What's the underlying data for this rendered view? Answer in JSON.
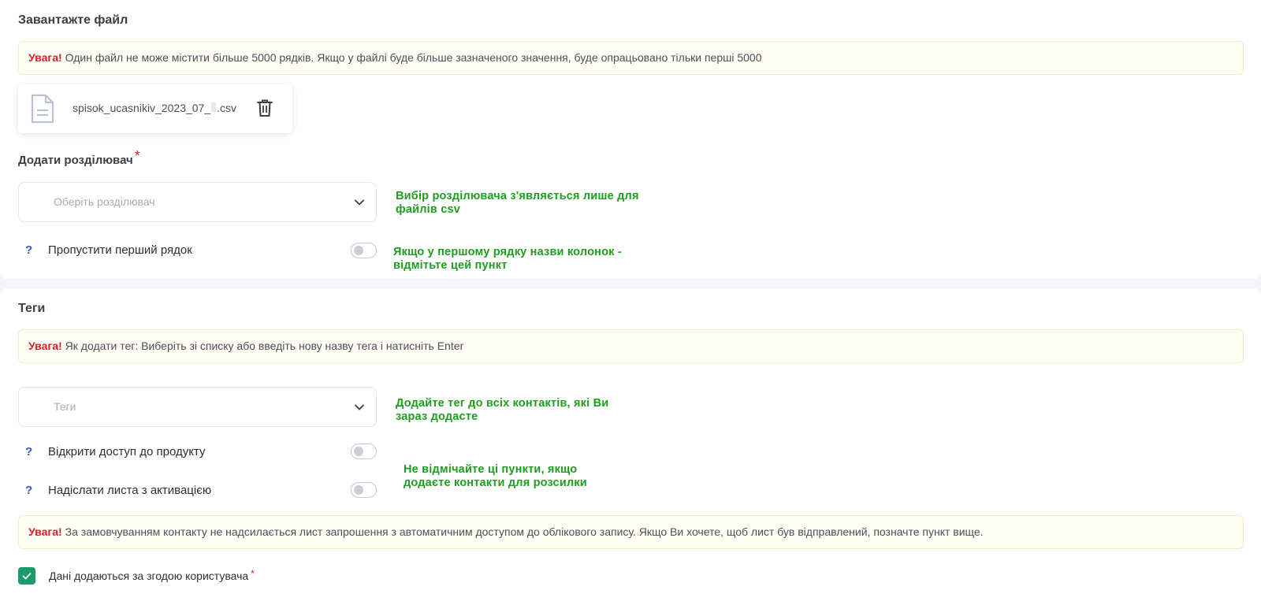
{
  "upload": {
    "title": "Завантажте файл",
    "notice_warn": "Увага!",
    "notice_text": "Один файл не може містити більше 5000 рядків. Якщо у файлі буде більше зазначеного значення, буде опрацьовано тільки перші 5000",
    "file_name": "spisok_ucasnikiv_2023_07_",
    "file_ext": ".csv",
    "file_icon": "document-icon",
    "delete_icon": "trash-icon"
  },
  "separator": {
    "label": "Додати розділювач",
    "required_mark": "*",
    "placeholder": "Оберіть розділювач",
    "hint_line1": "Вибір розділювача з'являється лише для",
    "hint_line2": "файлів csv"
  },
  "skip_first_row": {
    "help": "?",
    "label": "Пропустити перший рядок",
    "enabled": false,
    "hint_line1": "Якщо у першому рядку назви колонок -",
    "hint_line2": "відмітьте цей  пункт"
  },
  "tags": {
    "title": "Теги",
    "notice_warn": "Увага!",
    "notice_text": "Як додати тег: Виберіть зі списку або введіть нову назву тега і натисніть Enter",
    "placeholder": "Теги",
    "hint_line1": "Додайте тег до всіх контактів, які Ви",
    "hint_line2": "зараз додасте"
  },
  "open_access": {
    "help": "?",
    "label": "Відкрити доступ до продукту",
    "enabled": false
  },
  "send_activation": {
    "help": "?",
    "label": "Надіслати листа з активацією",
    "enabled": false
  },
  "access_hint": {
    "line1": "Не відмічайте ці пункти, якщо",
    "line2": "додаєте контакти для розсилки"
  },
  "invite_notice": {
    "warn": "Увага!",
    "text": "За замовчуванням контакту не надсилається лист запрошення з автоматичним доступом до облікового запису. Якщо Ви хочете, щоб лист був відправлений, позначте пункт вище."
  },
  "consent": {
    "label": "Дані додаються за згодою користувача",
    "required_mark": "*",
    "checked": true
  },
  "colors": {
    "warning_red": "#d6232b",
    "hint_green": "#1e9e1e",
    "checkbox_green": "#1d9a6c",
    "help_blue": "#3156d3"
  }
}
